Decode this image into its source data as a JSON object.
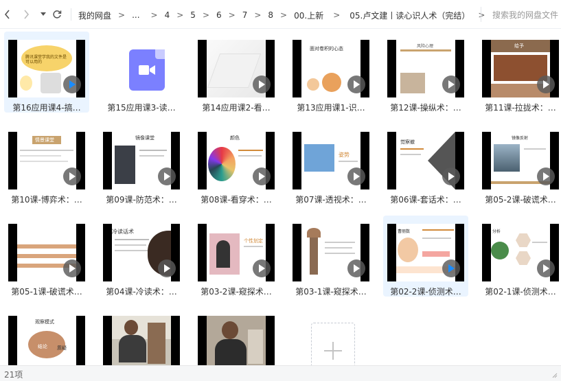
{
  "toolbar": {
    "back_icon": "chevron-left",
    "forward_icon": "chevron-right",
    "history_icon": "caret-down",
    "refresh_icon": "refresh"
  },
  "breadcrumb": {
    "items": [
      "我的网盘",
      "...",
      "4",
      "5",
      "6",
      "7",
      "8",
      "00.上新",
      "05.卢文建丨读心识人术（完结）"
    ],
    "separator": ">"
  },
  "search": {
    "placeholder": "搜索我的网盘文件"
  },
  "files": [
    {
      "label": "第16应用课4-搞…",
      "play": "blue"
    },
    {
      "label": "第15应用课3-读…",
      "play": "none"
    },
    {
      "label": "第14应用课2-看…",
      "play": "gray"
    },
    {
      "label": "第13应用课1-识…",
      "play": "gray"
    },
    {
      "label": "第12课-操纵术：…",
      "play": "gray"
    },
    {
      "label": "第11课-拉拢术：…",
      "play": "gray"
    },
    {
      "label": "第10课-博弈术：…",
      "play": "gray"
    },
    {
      "label": "第09课-防范术：…",
      "play": "gray"
    },
    {
      "label": "第08课-看穿术：…",
      "play": "gray"
    },
    {
      "label": "第07课-透视术：…",
      "play": "gray"
    },
    {
      "label": "第06课-套话术：…",
      "play": "gray"
    },
    {
      "label": "第05-2课-破谎术…",
      "play": "gray"
    },
    {
      "label": "第05-1课-破谎术…",
      "play": "gray"
    },
    {
      "label": "第04课-冷读术：…",
      "play": "gray"
    },
    {
      "label": "第03-2课-窥探术…",
      "play": "gray"
    },
    {
      "label": "第03-1课-窥探术…",
      "play": "gray"
    },
    {
      "label": "第02-2课-侦测术…",
      "play": "blue"
    },
    {
      "label": "第02-1课-侦测术…",
      "play": "gray"
    },
    {
      "label": "",
      "play": "none"
    },
    {
      "label": "",
      "play": "none"
    },
    {
      "label": "",
      "play": "none"
    }
  ],
  "thumb_text": {
    "t1": "腾讯课堂学我的文件是可以用的",
    "t4": "面对卷积的心态",
    "t5": "风险心理",
    "t6": "给予",
    "t7": "情景课堂",
    "t8": "镜像课堂",
    "t9": "颜色",
    "t10": "姿势",
    "t11": "觉察撤",
    "t12": "镜像反射",
    "t14": "冷读话术",
    "t15": "个性划定",
    "t17": "曹丽数",
    "t18": "分析",
    "t19": "观察模式",
    "t19b": "结论",
    "t19c": "质疑"
  },
  "status": {
    "count": "21项"
  },
  "colors": {
    "accent": "#1a8cff",
    "selected_bg": "#eaf4ff"
  }
}
